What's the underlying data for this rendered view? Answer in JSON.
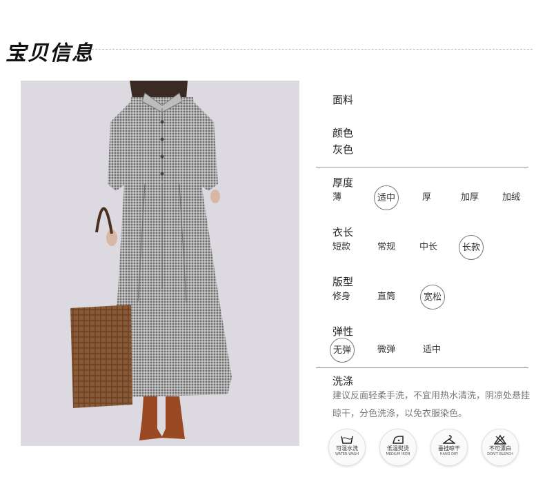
{
  "header": {
    "title": "宝贝信息"
  },
  "specs": {
    "fabric_label": "面料",
    "color_label": "颜色",
    "color_value": "灰色",
    "thickness": {
      "label": "厚度",
      "options": [
        "薄",
        "适中",
        "厚",
        "加厚",
        "加绒"
      ],
      "selected": "适中"
    },
    "length": {
      "label": "衣长",
      "options": [
        "短款",
        "常规",
        "中长",
        "长款"
      ],
      "selected": "长款"
    },
    "fit": {
      "label": "版型",
      "options": [
        "修身",
        "直筒",
        "宽松"
      ],
      "selected": "宽松"
    },
    "elasticity": {
      "label": "弹性",
      "options": [
        "无弹",
        "微弹",
        "适中"
      ],
      "selected": "无弹"
    }
  },
  "care": {
    "label": "洗涤",
    "text": "建议反面轻柔手洗，不宜用热水清洗，阴凉处悬挂晾干，分色洗涤，以免衣服染色。",
    "icons": [
      {
        "icon": "wash-tub-icon",
        "cn": "可温水洗",
        "en": "WATER WASH"
      },
      {
        "icon": "iron-icon",
        "cn": "低温熨烫",
        "en": "MEDIUM IRON"
      },
      {
        "icon": "hanger-icon",
        "cn": "垂挂晾干",
        "en": "HANG DRY"
      },
      {
        "icon": "no-bleach-icon",
        "cn": "不可漂白",
        "en": "DON'T BLEACH"
      }
    ]
  },
  "colors": {
    "photo_bg": "#ddd9e1",
    "dress": "#8e8e8e",
    "bag": "#8a5a36",
    "boots": "#9a4a22"
  }
}
